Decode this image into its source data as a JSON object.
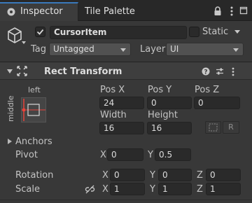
{
  "tabs": [
    {
      "label": "Inspector",
      "active": true
    },
    {
      "label": "Tile Palette",
      "active": false
    }
  ],
  "header": {
    "active_checked": true,
    "name": "CursorItem",
    "static_label": "Static",
    "static_checked": false,
    "tag_label": "Tag",
    "tag_value": "Untagged",
    "layer_label": "Layer",
    "layer_value": "UI"
  },
  "component": {
    "title": "Rect Transform",
    "anchor_preset": {
      "h": "left",
      "v": "middle"
    },
    "pos_x_label": "Pos X",
    "pos_y_label": "Pos Y",
    "pos_z_label": "Pos Z",
    "pos_x": "24",
    "pos_y": "0",
    "pos_z": "0",
    "width_label": "Width",
    "height_label": "Height",
    "width": "16",
    "height": "16",
    "raw_button": "R",
    "anchors_label": "Anchors",
    "pivot_label": "Pivot",
    "pivot_x_label": "X",
    "pivot_y_label": "Y",
    "pivot_x": "0",
    "pivot_y": "0.5",
    "rotation_label": "Rotation",
    "rot_x_label": "X",
    "rot_y_label": "Y",
    "rot_z_label": "Z",
    "rot_x": "0",
    "rot_y": "0",
    "rot_z": "0",
    "scale_label": "Scale",
    "scale_x_label": "X",
    "scale_y_label": "Y",
    "scale_z_label": "Z",
    "scale_x": "1",
    "scale_y": "1",
    "scale_z": "1"
  },
  "colors": {
    "background": "#383838",
    "tabbar": "#282828",
    "field": "#2a2a2a",
    "accent": "#e8433a"
  }
}
